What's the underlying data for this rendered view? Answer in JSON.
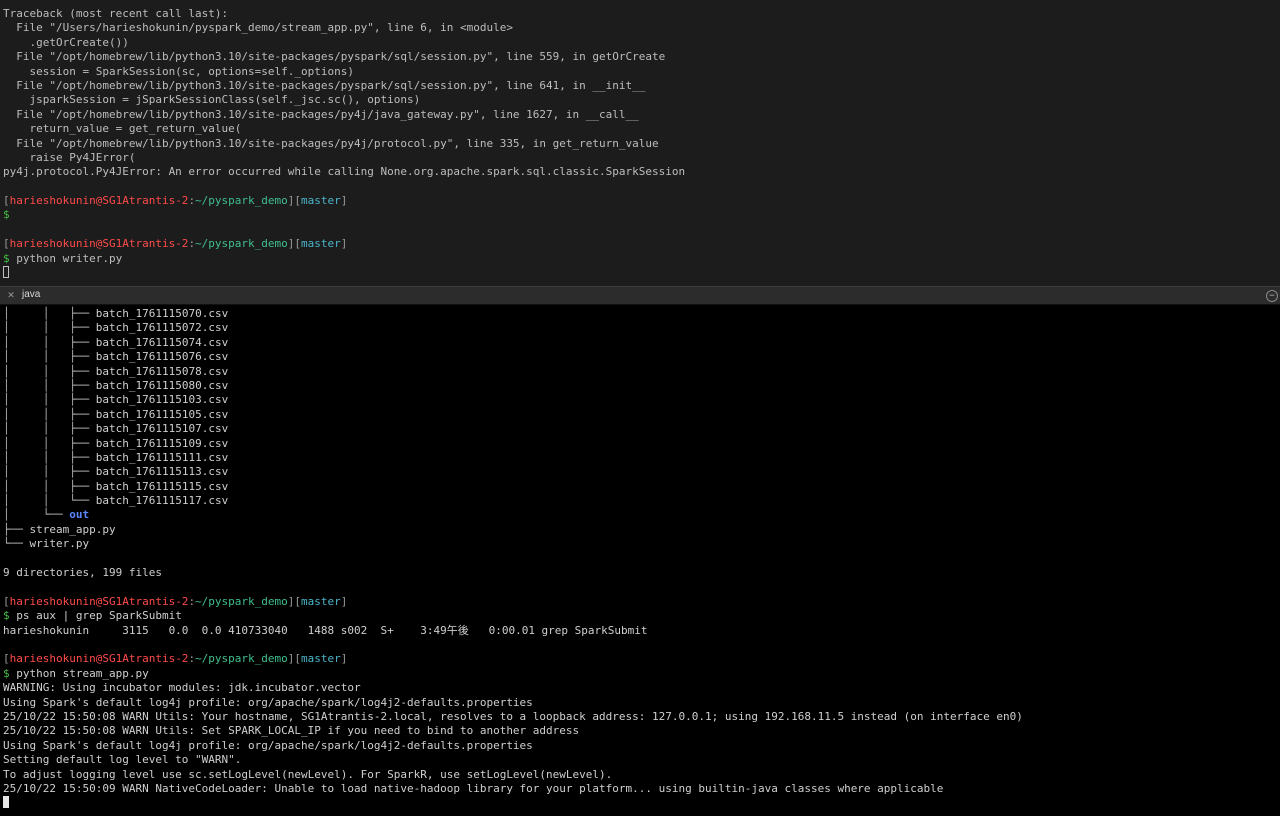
{
  "top_pane": {
    "traceback": [
      "Traceback (most recent call last):",
      "  File \"/Users/harieshokunin/pyspark_demo/stream_app.py\", line 6, in <module>",
      "    .getOrCreate())",
      "  File \"/opt/homebrew/lib/python3.10/site-packages/pyspark/sql/session.py\", line 559, in getOrCreate",
      "    session = SparkSession(sc, options=self._options)",
      "  File \"/opt/homebrew/lib/python3.10/site-packages/pyspark/sql/session.py\", line 641, in __init__",
      "    jsparkSession = jSparkSessionClass(self._jsc.sc(), options)",
      "  File \"/opt/homebrew/lib/python3.10/site-packages/py4j/java_gateway.py\", line 1627, in __call__",
      "    return_value = get_return_value(",
      "  File \"/opt/homebrew/lib/python3.10/site-packages/py4j/protocol.py\", line 335, in get_return_value",
      "    raise Py4JError(",
      "py4j.protocol.Py4JError: An error occurred while calling None.org.apache.spark.sql.classic.SparkSession"
    ],
    "prompt1": {
      "open": "[",
      "user": "harieshokunin@SG1Atrantis-2",
      "colon": ":",
      "cwd": "~/pyspark_demo",
      "mid": "][",
      "branch": "master",
      "close": "]",
      "dollar": "$"
    },
    "prompt2": {
      "open": "[",
      "user": "harieshokunin@SG1Atrantis-2",
      "colon": ":",
      "cwd": "~/pyspark_demo",
      "mid": "][",
      "branch": "master",
      "close": "]",
      "dollar": "$",
      "command": " python writer.py"
    }
  },
  "tabbar": {
    "close_glyph": "✕",
    "title": "java",
    "add_glyph": "−"
  },
  "bottom_pane": {
    "tree_prefix": "│     │   ",
    "batch_files": [
      {
        "branch": "├── ",
        "name": "batch_1761115070.csv"
      },
      {
        "branch": "├── ",
        "name": "batch_1761115072.csv"
      },
      {
        "branch": "├── ",
        "name": "batch_1761115074.csv"
      },
      {
        "branch": "├── ",
        "name": "batch_1761115076.csv"
      },
      {
        "branch": "├── ",
        "name": "batch_1761115078.csv"
      },
      {
        "branch": "├── ",
        "name": "batch_1761115080.csv"
      },
      {
        "branch": "├── ",
        "name": "batch_1761115103.csv"
      },
      {
        "branch": "├── ",
        "name": "batch_1761115105.csv"
      },
      {
        "branch": "├── ",
        "name": "batch_1761115107.csv"
      },
      {
        "branch": "├── ",
        "name": "batch_1761115109.csv"
      },
      {
        "branch": "├── ",
        "name": "batch_1761115111.csv"
      },
      {
        "branch": "├── ",
        "name": "batch_1761115113.csv"
      },
      {
        "branch": "├── ",
        "name": "batch_1761115115.csv"
      },
      {
        "branch": "└── ",
        "name": "batch_1761115117.csv"
      }
    ],
    "out_prefix": "│     └── ",
    "out_dir": "out",
    "stream_app": {
      "branch": "├── ",
      "name": "stream_app.py"
    },
    "writer": {
      "branch": "└── ",
      "name": "writer.py"
    },
    "summary": "9 directories, 199 files",
    "prompt3": {
      "open": "[",
      "user": "harieshokunin@SG1Atrantis-2",
      "colon": ":",
      "cwd": "~/pyspark_demo",
      "mid": "][",
      "branch": "master",
      "close": "]",
      "dollar": "$",
      "command": " ps aux | grep SparkSubmit"
    },
    "ps_output": "harieshokunin     3115   0.0  0.0 410733040   1488 s002  S+    3:49午後   0:00.01 grep SparkSubmit",
    "prompt4": {
      "open": "[",
      "user": "harieshokunin@SG1Atrantis-2",
      "colon": ":",
      "cwd": "~/pyspark_demo",
      "mid": "][",
      "branch": "master",
      "close": "]",
      "dollar": "$",
      "command": " python stream_app.py"
    },
    "logs": [
      "WARNING: Using incubator modules: jdk.incubator.vector",
      "Using Spark's default log4j profile: org/apache/spark/log4j2-defaults.properties",
      "25/10/22 15:50:08 WARN Utils: Your hostname, SG1Atrantis-2.local, resolves to a loopback address: 127.0.0.1; using 192.168.11.5 instead (on interface en0)",
      "25/10/22 15:50:08 WARN Utils: Set SPARK_LOCAL_IP if you need to bind to another address",
      "Using Spark's default log4j profile: org/apache/spark/log4j2-defaults.properties",
      "Setting default log level to \"WARN\".",
      "To adjust logging level use sc.setLogLevel(newLevel). For SparkR, use setLogLevel(newLevel).",
      "25/10/22 15:50:09 WARN NativeCodeLoader: Unable to load native-hadoop library for your platform... using builtin-java classes where applicable"
    ]
  }
}
